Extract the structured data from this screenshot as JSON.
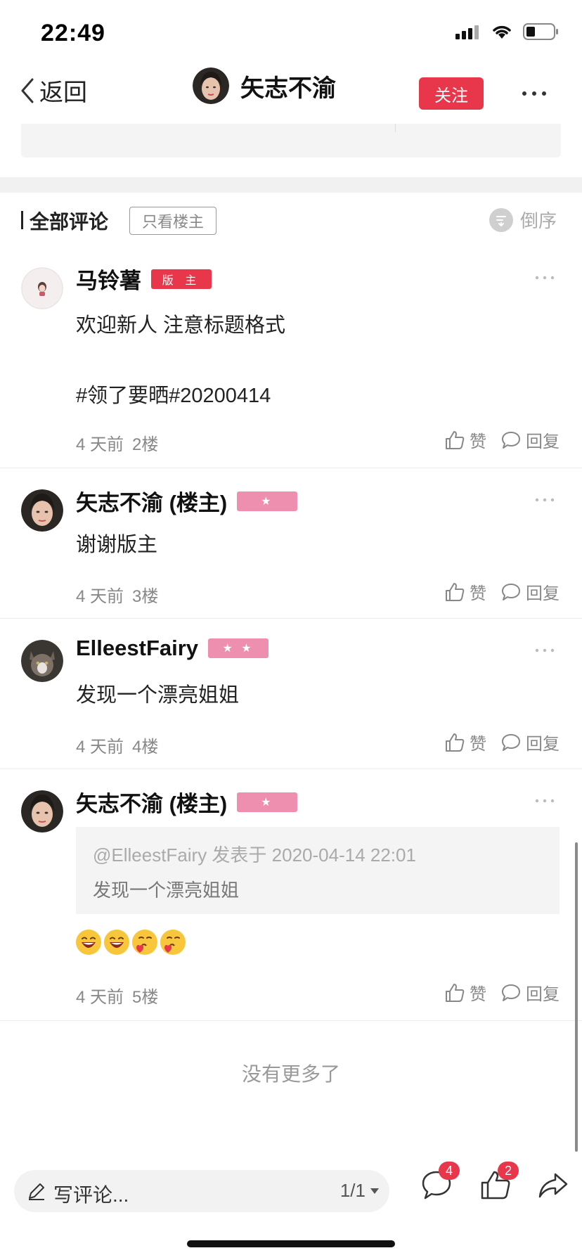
{
  "status_bar": {
    "time": "22:49"
  },
  "nav": {
    "back_label": "返回",
    "title": "矢志不渝",
    "follow_label": "关注"
  },
  "comments_header": {
    "title": "全部评论",
    "only_owner_label": "只看楼主",
    "sort_label": "倒序"
  },
  "comments": [
    {
      "name": "马铃薯",
      "badge": "版 主",
      "text_lines": [
        "欢迎新人 注意标题格式",
        "",
        "#领了要晒#20200414"
      ],
      "time": "4 天前",
      "floor": "2楼",
      "like_label": "赞",
      "reply_label": "回复"
    },
    {
      "name": "矢志不渝 (楼主)",
      "badge": "★",
      "text_lines": [
        "谢谢版主"
      ],
      "time": "4 天前",
      "floor": "3楼",
      "like_label": "赞",
      "reply_label": "回复"
    },
    {
      "name": "ElleestFairy",
      "badge": "★ ★",
      "text_lines": [
        "发现一个漂亮姐姐"
      ],
      "time": "4 天前",
      "floor": "4楼",
      "like_label": "赞",
      "reply_label": "回复"
    },
    {
      "name": "矢志不渝 (楼主)",
      "badge": "★",
      "quote": {
        "header": "@ElleestFairy 发表于 2020-04-14 22:01",
        "text": "发现一个漂亮姐姐"
      },
      "emojis": [
        "laughing-emoji",
        "laughing-emoji",
        "thinking-heart-emoji",
        "thinking-heart-emoji"
      ],
      "time": "4 天前",
      "floor": "5楼",
      "like_label": "赞",
      "reply_label": "回复"
    }
  ],
  "footer_note": "没有更多了",
  "bottom_bar": {
    "input_placeholder": "写评论...",
    "page_indicator": "1/1",
    "comment_count": "4",
    "like_count": "2"
  },
  "colors": {
    "accent_red": "#e8364a",
    "level_pink": "#ee8fb0"
  }
}
